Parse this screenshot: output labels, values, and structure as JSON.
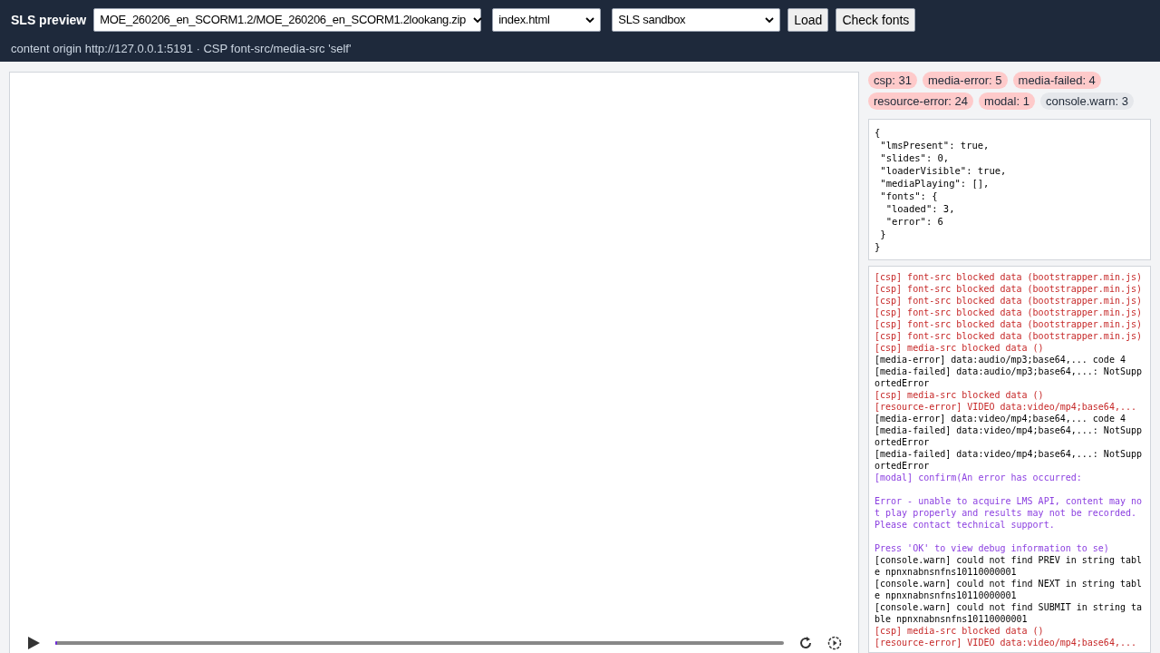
{
  "header": {
    "title": "SLS preview",
    "package_select": "MOE_260206_en_SCORM1.2/MOE_260206_en_SCORM1.2lookang.zip",
    "page_select": "index.html",
    "mode_select": "SLS sandbox",
    "buttons": [
      "Load",
      "Check fonts"
    ],
    "origin_note": "content origin http://127.0.0.1:5191 · CSP font-src/media-src 'self'"
  },
  "player": {
    "progress": {
      "level": 0
    }
  },
  "counters": [
    {
      "label": "csp: 31",
      "kind": "error"
    },
    {
      "label": "media-error: 5",
      "kind": "error"
    },
    {
      "label": "media-failed: 4",
      "kind": "error"
    },
    {
      "label": "resource-error: 24",
      "kind": "error"
    },
    {
      "label": "modal: 1",
      "kind": "error"
    },
    {
      "label": "console.warn: 3",
      "kind": "neutral"
    }
  ],
  "state_json": "{\n \"lmsPresent\": true,\n \"slides\": 0,\n \"loaderVisible\": true,\n \"mediaPlaying\": [],\n \"fonts\": {\n  \"loaded\": 3,\n  \"error\": 6\n }\n}",
  "log": [
    {
      "kind": "csp",
      "text": "[csp] font-src blocked data (bootstrapper.min.js)"
    },
    {
      "kind": "csp",
      "text": "[csp] font-src blocked data (bootstrapper.min.js)"
    },
    {
      "kind": "csp",
      "text": "[csp] font-src blocked data (bootstrapper.min.js)"
    },
    {
      "kind": "csp",
      "text": "[csp] font-src blocked data (bootstrapper.min.js)"
    },
    {
      "kind": "csp",
      "text": "[csp] font-src blocked data (bootstrapper.min.js)"
    },
    {
      "kind": "csp",
      "text": "[csp] font-src blocked data (bootstrapper.min.js)"
    },
    {
      "kind": "csp",
      "text": "[csp] media-src blocked data ()"
    },
    {
      "kind": "error",
      "text": "[media-error] data:audio/mp3;base64,... code 4"
    },
    {
      "kind": "failed",
      "text": "[media-failed] data:audio/mp3;base64,...: NotSupportedError"
    },
    {
      "kind": "csp",
      "text": "[csp] media-src blocked data ()"
    },
    {
      "kind": "resource",
      "text": "[resource-error] VIDEO data:video/mp4;base64,..."
    },
    {
      "kind": "error",
      "text": "[media-error] data:video/mp4;base64,... code 4"
    },
    {
      "kind": "failed",
      "text": "[media-failed] data:video/mp4;base64,...: NotSupportedError"
    },
    {
      "kind": "failed",
      "text": "[media-failed] data:video/mp4;base64,...: NotSupportedError"
    },
    {
      "kind": "modal",
      "text": "[modal] confirm(An error has occurred:\n\nError - unable to acquire LMS API, content may not play properly and results may not be recorded.  Please contact technical support.\n\nPress 'OK' to view debug information to se)"
    },
    {
      "kind": "warn",
      "text": "[console.warn] could not find PREV in string table npnxnabnsnfns10110000001"
    },
    {
      "kind": "warn",
      "text": "[console.warn] could not find NEXT in string table npnxnabnsnfns10110000001"
    },
    {
      "kind": "warn",
      "text": "[console.warn] could not find SUBMIT in string table npnxnabnsnfns10110000001"
    },
    {
      "kind": "csp",
      "text": "[csp] media-src blocked data ()"
    },
    {
      "kind": "resource",
      "text": "[resource-error] VIDEO data:video/mp4;base64,..."
    }
  ]
}
